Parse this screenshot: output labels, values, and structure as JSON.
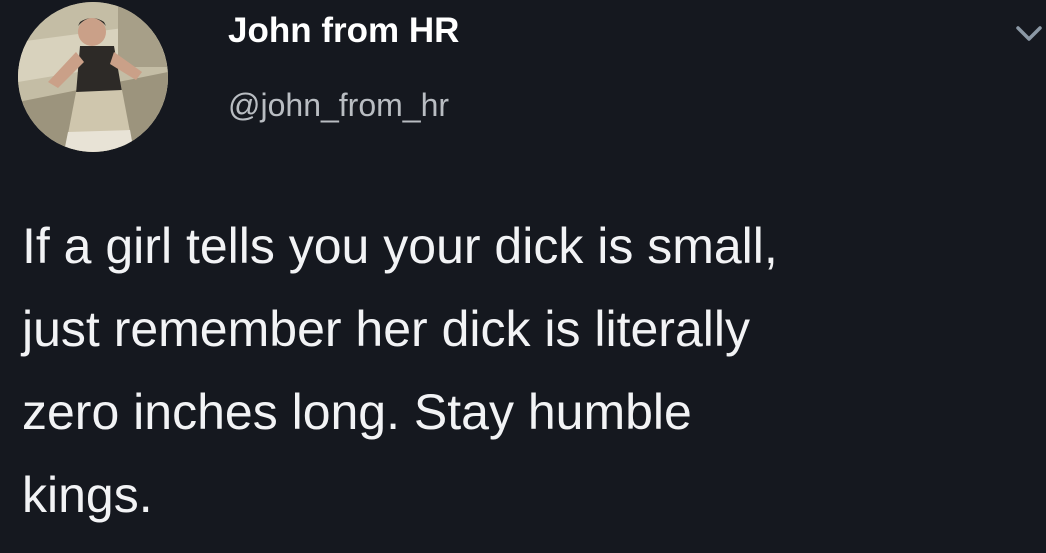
{
  "tweet": {
    "author": {
      "display_name": "John from HR",
      "handle": "@john_from_hr"
    },
    "text_lines": [
      "If a girl tells you your dick is small,",
      "just remember her dick is literally",
      "zero inches long. Stay humble",
      "kings."
    ],
    "menu_icon": "chevron-down-icon",
    "avatar_icon": "avatar"
  },
  "colors": {
    "background": "#15181f",
    "name": "#ffffff",
    "handle": "#b9bdc2",
    "text": "#f2f3f5"
  }
}
